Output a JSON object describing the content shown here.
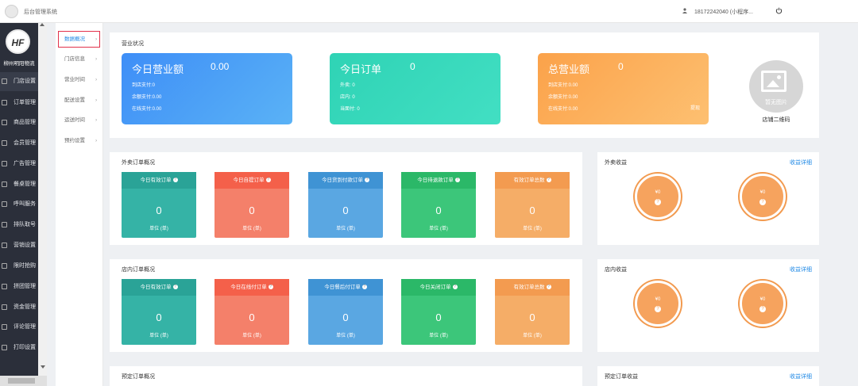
{
  "topbar": {
    "system_title": "后台管理系统",
    "user_phone": "18172242040 (小程序..."
  },
  "sidebar": {
    "avatar_text": "HF",
    "shop_name": "柳州明阳物流",
    "items": [
      {
        "label": "门店设置"
      },
      {
        "label": "订单管理"
      },
      {
        "label": "商品管理"
      },
      {
        "label": "会员管理"
      },
      {
        "label": "广告管理"
      },
      {
        "label": "餐桌管理"
      },
      {
        "label": "呼叫服务"
      },
      {
        "label": "排队取号"
      },
      {
        "label": "营销设置"
      },
      {
        "label": "限时抢购"
      },
      {
        "label": "拼团管理"
      },
      {
        "label": "资金管理"
      },
      {
        "label": "评论管理"
      },
      {
        "label": "打印设置"
      }
    ]
  },
  "subnav": {
    "items": [
      {
        "label": "数据概况"
      },
      {
        "label": "门店信息"
      },
      {
        "label": "营业时间"
      },
      {
        "label": "配送设置"
      },
      {
        "label": "运送时间"
      },
      {
        "label": "预约设置"
      }
    ]
  },
  "overview": {
    "title": "营业状况",
    "cards": [
      {
        "title": "今日营业额",
        "value": "0.00",
        "lines": [
          "到店支付:0",
          "余额支付:0.00",
          "在线支付:0.00"
        ],
        "extra": ""
      },
      {
        "title": "今日订单",
        "value": "0",
        "lines": [
          "外卖: 0",
          "店内: 0",
          "当面付: 0"
        ],
        "extra": ""
      },
      {
        "title": "总营业额",
        "value": "0",
        "lines": [
          "到店支付:0.00",
          "余额支付:0.00",
          "在线支付:0.00"
        ],
        "extra": "提现"
      }
    ],
    "qr_placeholder": "暂无图片",
    "qr_label": "店铺二维码"
  },
  "takeout": {
    "title": "外卖订单概况",
    "cards": [
      {
        "label": "今日有效订单",
        "value": "0",
        "unit": "单位 (单)"
      },
      {
        "label": "今日自提订单",
        "value": "0",
        "unit": "单位 (单)"
      },
      {
        "label": "今日货到付款订单",
        "value": "0",
        "unit": "单位 (单)"
      },
      {
        "label": "今日待退款订单",
        "value": "0",
        "unit": "单位 (单)"
      },
      {
        "label": "有效订单总数",
        "value": "0",
        "unit": "单位 (单)"
      }
    ]
  },
  "takeout_income": {
    "title": "外卖收益",
    "link": "收益详细",
    "amounts": [
      "¥0",
      "¥0"
    ]
  },
  "instore": {
    "title": "店内订单概况",
    "cards": [
      {
        "label": "今日有效订单",
        "value": "0",
        "unit": "单位 (单)"
      },
      {
        "label": "今日在线付订单",
        "value": "0",
        "unit": "单位 (单)"
      },
      {
        "label": "今日餐后付订单",
        "value": "0",
        "unit": "单位 (单)"
      },
      {
        "label": "今日关闭订单",
        "value": "0",
        "unit": "单位 (单)"
      },
      {
        "label": "有效订单总数",
        "value": "0",
        "unit": "单位 (单)"
      }
    ]
  },
  "instore_income": {
    "title": "店内收益",
    "link": "收益详细",
    "amounts": [
      "¥0",
      "¥0"
    ]
  },
  "reserve": {
    "title": "预定订单概况"
  },
  "reserve_income": {
    "title": "预定订单收益",
    "link": "收益详细"
  },
  "colors": {
    "teal": "#2fb1a3",
    "red": "#f36b50",
    "blue": "#3f9ce0",
    "green": "#2dc770",
    "orange": "#f7a14f"
  }
}
